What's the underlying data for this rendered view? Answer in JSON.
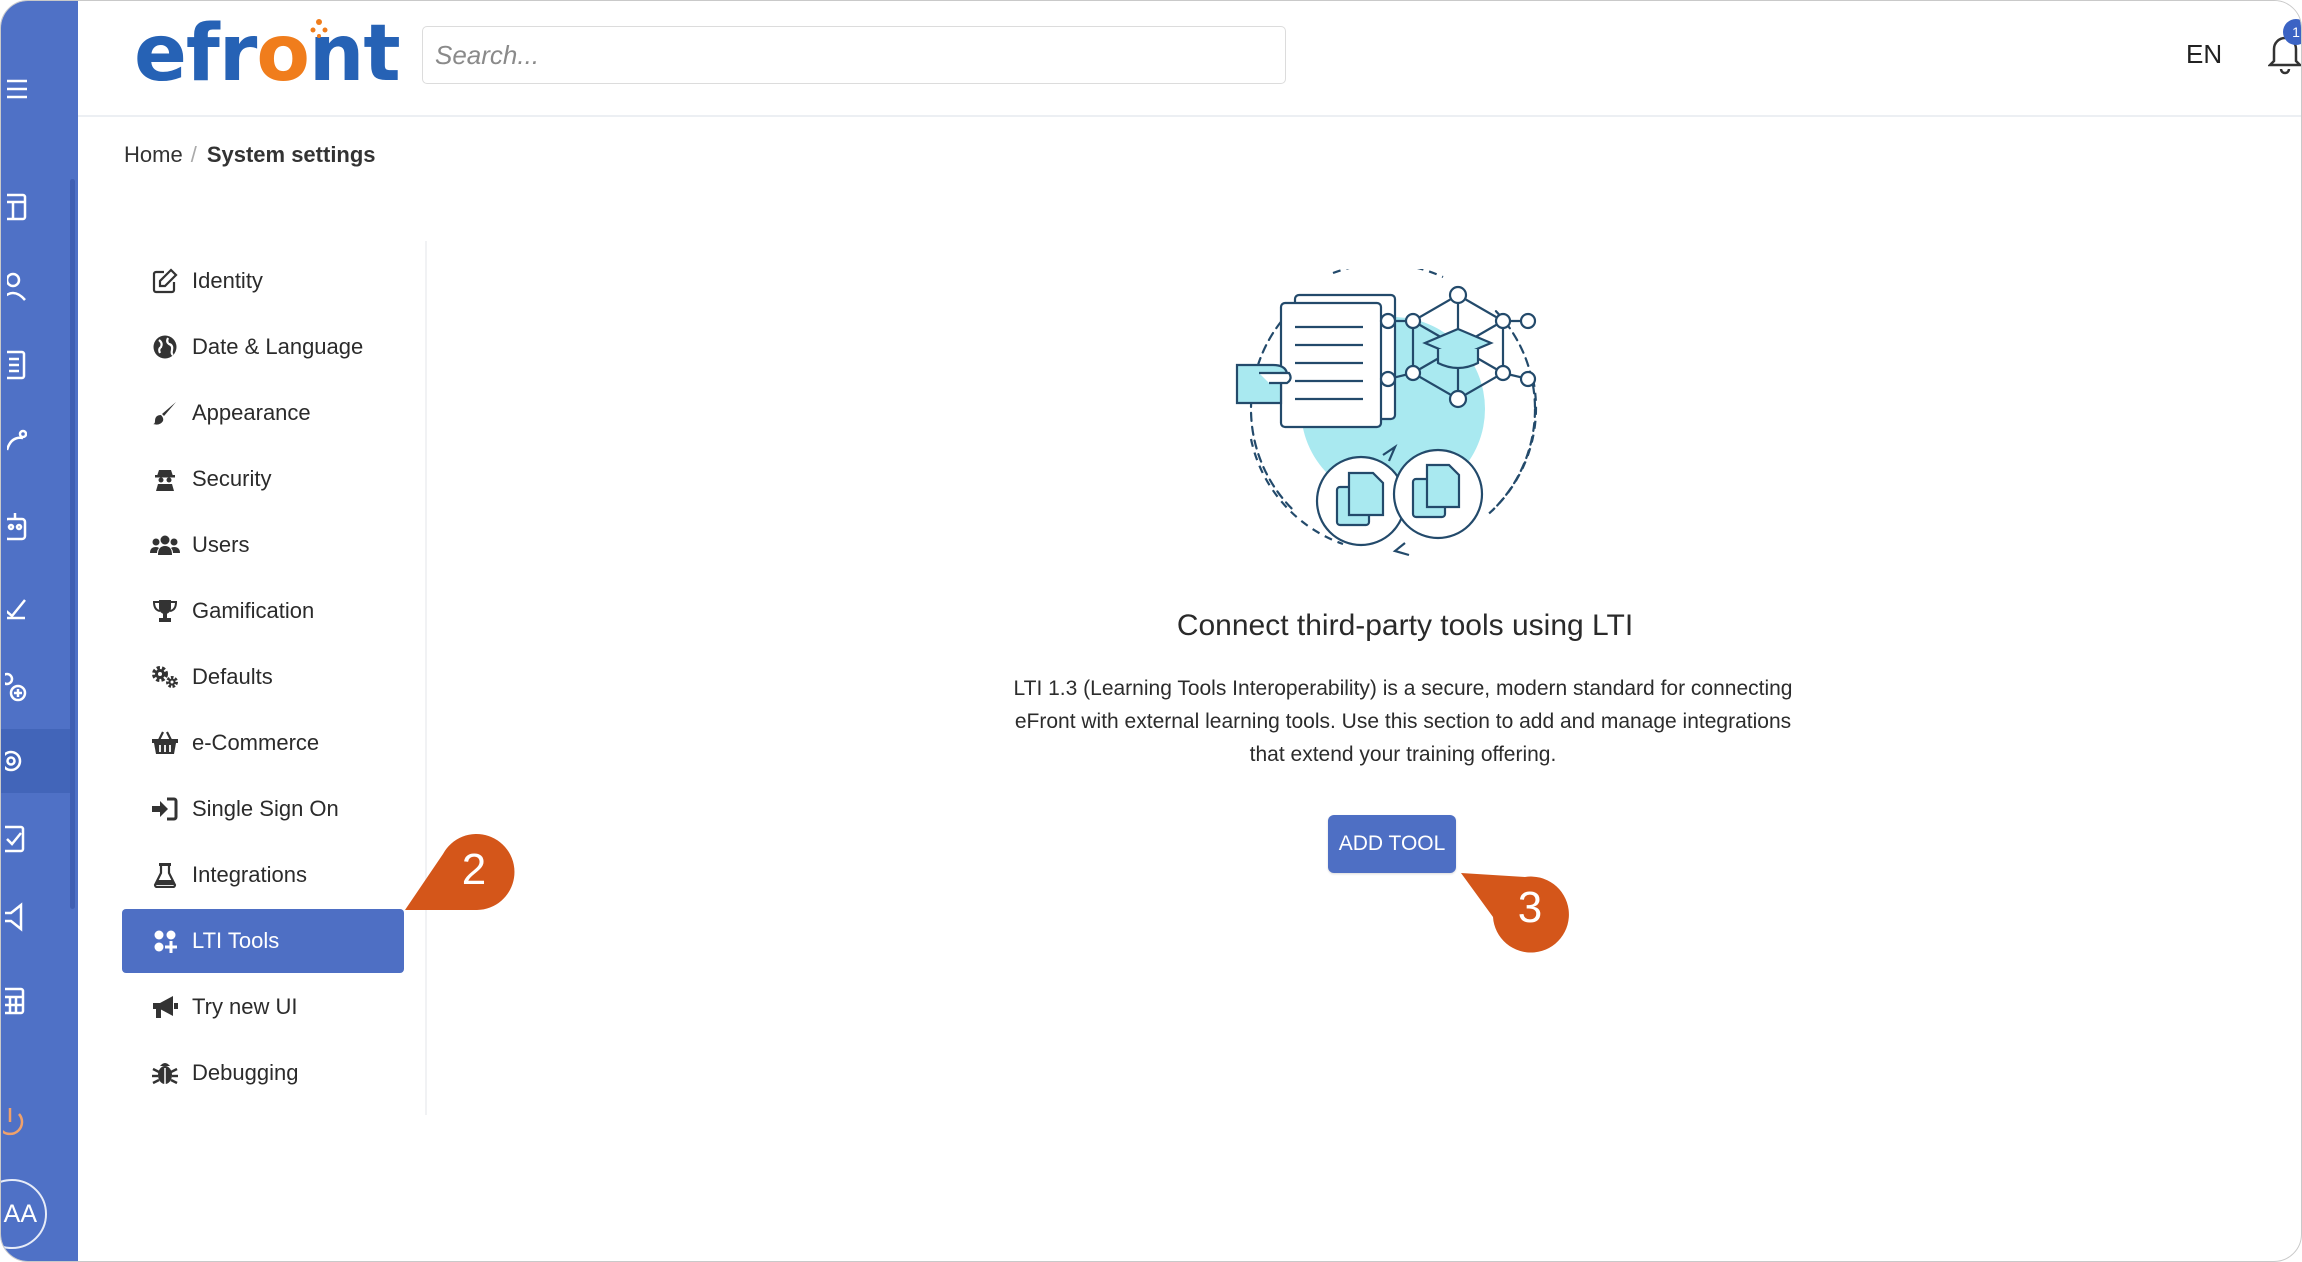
{
  "header": {
    "logo_text_pre": "efr",
    "logo_text_o": "o",
    "logo_text_post": "nt",
    "search_placeholder": "Search...",
    "language": "EN",
    "notification_count": "1"
  },
  "user": {
    "initials": "AA"
  },
  "breadcrumb": {
    "home": "Home",
    "separator": "/",
    "current": "System settings"
  },
  "settings_nav": [
    {
      "label": "Identity",
      "icon": "edit-icon"
    },
    {
      "label": "Date & Language",
      "icon": "globe-icon"
    },
    {
      "label": "Appearance",
      "icon": "paintbrush-icon"
    },
    {
      "label": "Security",
      "icon": "user-secret-icon"
    },
    {
      "label": "Users",
      "icon": "users-icon"
    },
    {
      "label": "Gamification",
      "icon": "trophy-icon"
    },
    {
      "label": "Defaults",
      "icon": "cogs-icon"
    },
    {
      "label": "e-Commerce",
      "icon": "basket-icon"
    },
    {
      "label": "Single Sign On",
      "icon": "sign-in-icon"
    },
    {
      "label": "Integrations",
      "icon": "flask-icon"
    },
    {
      "label": "LTI Tools",
      "icon": "puzzle-icon",
      "active": true
    },
    {
      "label": "Try new UI",
      "icon": "megaphone-icon"
    },
    {
      "label": "Debugging",
      "icon": "bug-icon"
    }
  ],
  "main": {
    "title": "Connect third-party tools using LTI",
    "description": "LTI 1.3 (Learning Tools Interoperability) is a secure, modern standard for connecting eFront with external learning tools. Use this section to add and manage integrations that extend your training offering.",
    "add_tool_label": "ADD TOOL"
  },
  "callouts": {
    "step_2": "2",
    "step_3": "3"
  },
  "colors": {
    "rail": "#4f71c6",
    "accent": "#4e6fc4",
    "callout": "#d4561a",
    "logo_blue": "#2662b5",
    "logo_orange": "#f07d1c"
  }
}
